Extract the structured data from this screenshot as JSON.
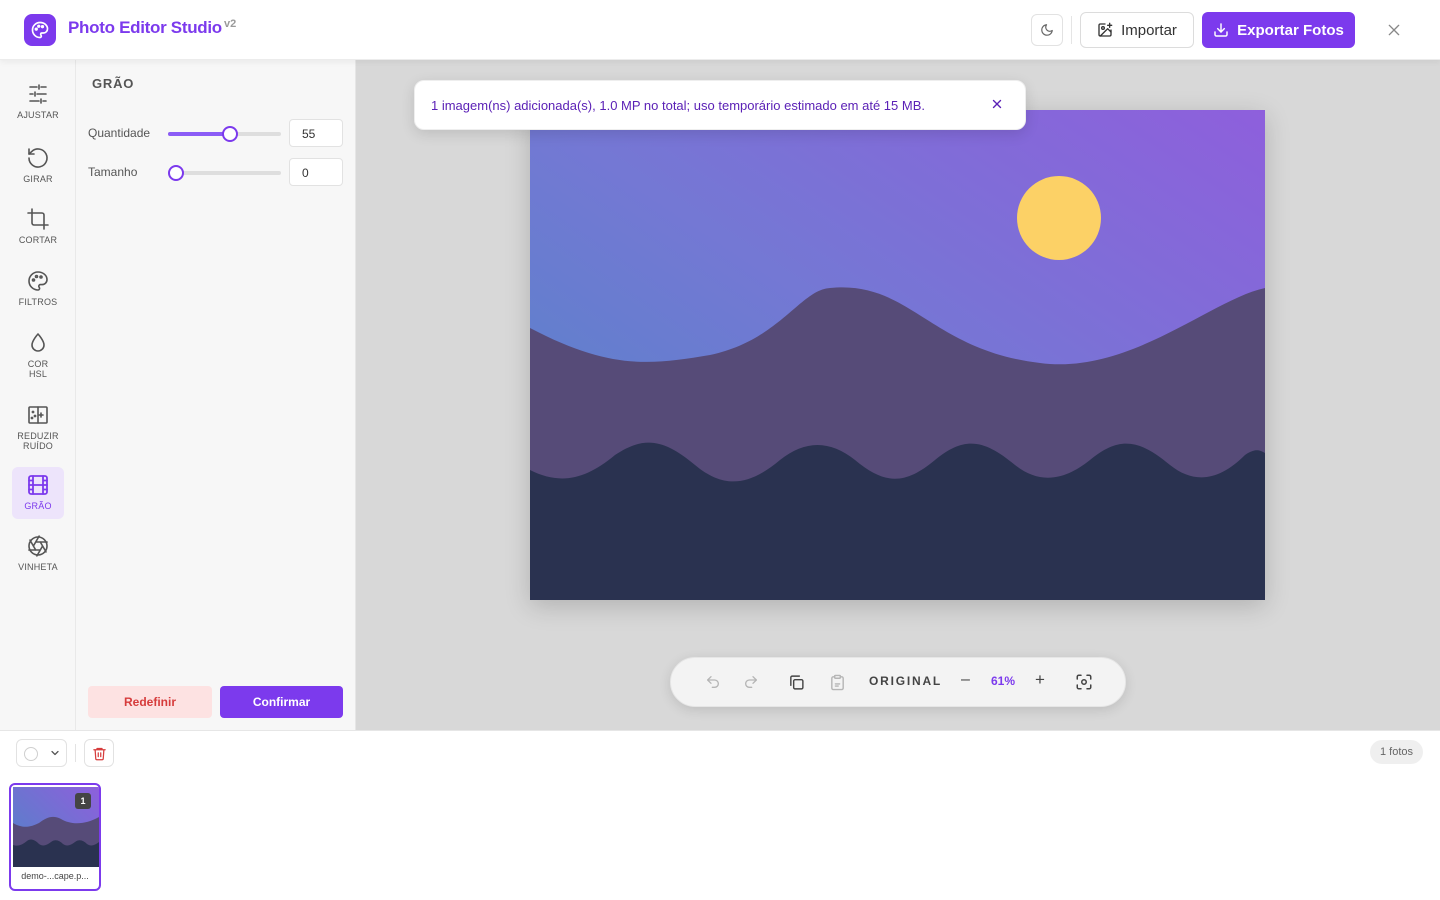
{
  "header": {
    "title": "Photo Editor Studio",
    "version": "v2",
    "theme_icon": "moon-icon",
    "import_label": "Importar",
    "export_label": "Exportar Fotos",
    "close_icon": "close-icon"
  },
  "colors": {
    "accent": "#7c3aed",
    "danger": "#d63c3c",
    "danger_bg": "#fde2e2",
    "canvas_bg": "#d8d8d8"
  },
  "nav": {
    "items": [
      {
        "label": "AJUSTAR",
        "icon": "sliders-icon",
        "active": false
      },
      {
        "label": "GIRAR",
        "icon": "rotate-icon",
        "active": false
      },
      {
        "label": "CORTAR",
        "icon": "crop-icon",
        "active": false
      },
      {
        "label": "FILTROS",
        "icon": "palette-icon",
        "active": false
      },
      {
        "label": "COR HSL",
        "icon": "droplet-icon",
        "active": false
      },
      {
        "label": "REDUZIR RUÍDO",
        "icon": "denoise-icon",
        "active": false
      },
      {
        "label": "GRÃO",
        "icon": "film-icon",
        "active": true
      },
      {
        "label": "VINHETA",
        "icon": "aperture-icon",
        "active": false
      }
    ]
  },
  "panel": {
    "title": "GRÃO",
    "sliders": [
      {
        "label": "Quantidade",
        "value": "55",
        "fraction": 0.55
      },
      {
        "label": "Tamanho",
        "value": "0",
        "fraction": 0.0
      }
    ],
    "reset_label": "Redefinir",
    "confirm_label": "Confirmar"
  },
  "toast": {
    "message": "1 imagem(ns) adicionada(s), 1.0 MP no total; uso temporário estimado em até 15 MB."
  },
  "toolbar": {
    "original_label": "ORIGINAL",
    "zoom_out": "–",
    "zoom_level": "61%",
    "zoom_in": "+"
  },
  "filmstrip": {
    "photos_count": "1 fotos",
    "thumbnails": [
      {
        "name": "demo-...cape.p...",
        "index": "1"
      }
    ]
  }
}
